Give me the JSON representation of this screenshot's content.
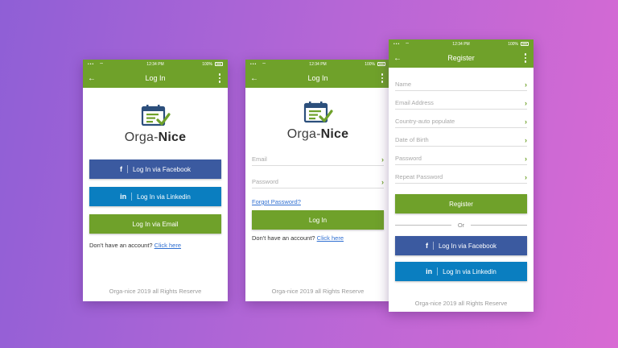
{
  "status": {
    "time": "12:34 PM",
    "battery": "100%",
    "signal": "•••"
  },
  "brand": {
    "name_prefix": "Orga-",
    "name_suffix": "Nice"
  },
  "colors": {
    "green": "#6fa12a",
    "facebook": "#3b5aa0",
    "linkedin": "#0a7ec0",
    "link": "#2f6fd1"
  },
  "icons": {
    "back": "arrow-left-icon",
    "menu": "kebab-menu-icon",
    "field": "chevron-right-icon"
  },
  "screen1": {
    "title": "Log In",
    "facebook_icon": "f",
    "facebook_label": "Log In via Facebook",
    "linkedin_icon": "in",
    "linkedin_label": "Log In via Linkedin",
    "email_label": "Log In via Email",
    "no_account": "Don't have an account?",
    "click_here": "Click here",
    "footer": "Orga-nice 2019 all Rights Reserve"
  },
  "screen2": {
    "title": "Log In",
    "email_placeholder": "Email",
    "password_placeholder": "Password",
    "forgot": "Forgot Password?",
    "login_label": "Log In",
    "no_account": "Don't have an account?",
    "click_here": "Click here",
    "footer": "Orga-nice 2019 all Rights Reserve"
  },
  "screen3": {
    "title": "Register",
    "fields": [
      "Name",
      "Email Address",
      "Country-auto populate",
      "Date of Birth",
      "Password",
      "Repeat Password"
    ],
    "register_label": "Register",
    "or": "Or",
    "facebook_icon": "f",
    "facebook_label": "Log In via Facebook",
    "linkedin_icon": "in",
    "linkedin_label": "Log In via Linkedin",
    "footer": "Orga-nice 2019 all Rights Reserve"
  }
}
